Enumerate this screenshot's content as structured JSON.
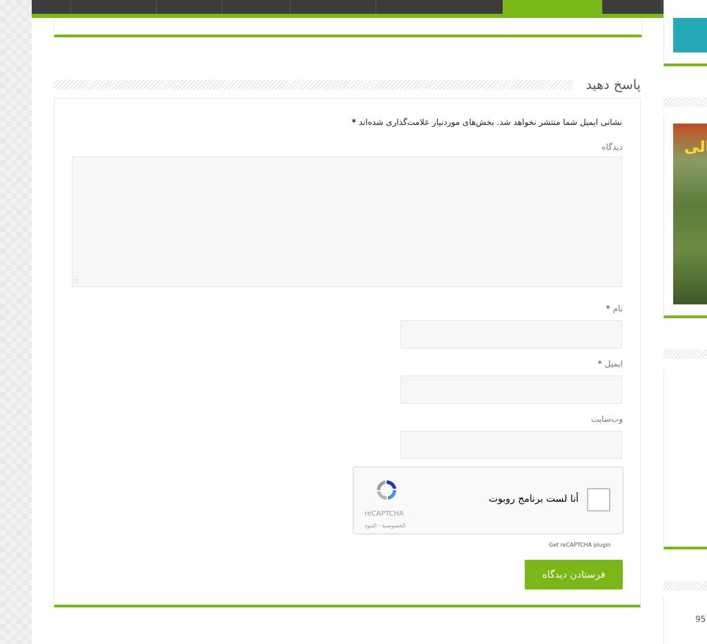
{
  "comment_form": {
    "title": "پاسخ دهید",
    "notes": "نشانی ایمیل شما منتشر نخواهد شد. بخش‌های موردنیاز علامت‌گذاری شده‌اند",
    "required_mark": "*",
    "comment_label": "دیدگاه",
    "name_label": "نام",
    "email_label": "ایمیل",
    "website_label": "وب‌سایت",
    "submit_label": "فرستادن دیدگاه"
  },
  "recaptcha": {
    "checkbox_label": "أنا لست برنامج روبوت",
    "brand": "reCAPTCHA",
    "links": "الخصوصية - البنود",
    "plugin_link": "Get reCAPTCHA plugin"
  },
  "sidebar": {
    "cover_text": "ــالی",
    "partial_number": "95"
  },
  "colors": {
    "accent": "#7ab817",
    "nav_bg": "#3c3c3c",
    "teal": "#25a9b7"
  }
}
